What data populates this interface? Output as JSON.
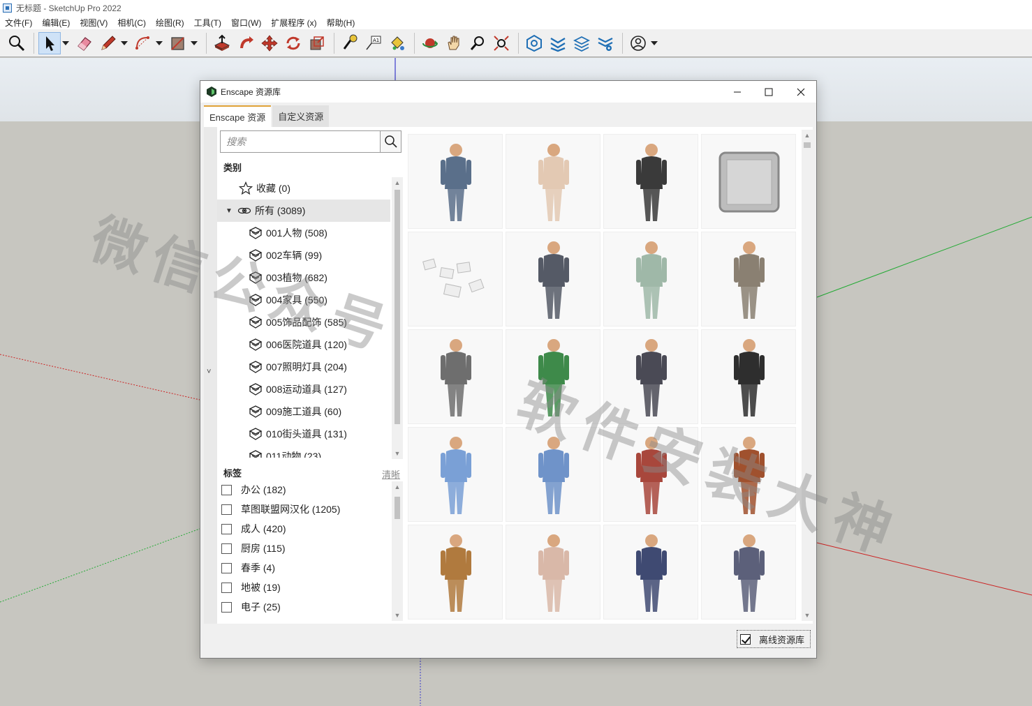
{
  "app": {
    "title": "无标题 - SketchUp Pro 2022",
    "menus": [
      "文件(F)",
      "编辑(E)",
      "视图(V)",
      "相机(C)",
      "绘图(R)",
      "工具(T)",
      "窗口(W)",
      "扩展程序 (x)",
      "帮助(H)"
    ]
  },
  "toolbar": {
    "tools": [
      "zoom-icon",
      "select-icon",
      "eraser-icon",
      "pencil-icon",
      "arc-icon",
      "shape-icon",
      "push-pull-icon",
      "follow-me-icon",
      "move-icon",
      "rotate-icon",
      "scale-icon",
      "tape-measure-icon",
      "text-icon",
      "paint-bucket-icon",
      "orbit-icon",
      "pan-icon",
      "zoom-window-icon",
      "zoom-extents-icon",
      "warehouse-icon",
      "components-icon",
      "extension-warehouse-icon",
      "settings-icon",
      "account-icon"
    ]
  },
  "dialog": {
    "title": "Enscape 资源库",
    "tabs": {
      "builtin": "Enscape 资源",
      "custom": "自定义资源"
    },
    "search": {
      "placeholder": "搜索",
      "value": ""
    },
    "category_title": "类别",
    "categories": [
      {
        "label": "收藏 (0)",
        "icon": "star-icon"
      },
      {
        "label": "所有 (3089)",
        "icon": "all-icon"
      },
      {
        "label": "001人物 (508)",
        "icon": "category-icon"
      },
      {
        "label": "002车辆 (99)",
        "icon": "category-icon"
      },
      {
        "label": "003植物 (682)",
        "icon": "category-icon"
      },
      {
        "label": "004家具 (550)",
        "icon": "category-icon"
      },
      {
        "label": "005饰品配饰 (585)",
        "icon": "category-icon"
      },
      {
        "label": "006医院道具 (120)",
        "icon": "category-icon"
      },
      {
        "label": "007照明灯具 (204)",
        "icon": "category-icon"
      },
      {
        "label": "008运动道具 (127)",
        "icon": "category-icon"
      },
      {
        "label": "009施工道具 (60)",
        "icon": "category-icon"
      },
      {
        "label": "010街头道具 (131)",
        "icon": "category-icon"
      },
      {
        "label": "011动物 (23)",
        "icon": "category-icon"
      }
    ],
    "tags_title": "标签",
    "clear_label": "清晰",
    "tags": [
      "办公 (182)",
      "草图联盟网汉化 (1205)",
      "成人 (420)",
      "厨房 (115)",
      "春季 (4)",
      "地被 (19)",
      "电子 (25)"
    ],
    "offline_label": "离线资源库",
    "offline_checked": true,
    "assets": [
      {
        "name": "man-on-phone",
        "color": "#5a6f8a"
      },
      {
        "name": "woman-in-suit",
        "color": "#e3c9b3"
      },
      {
        "name": "waiter-with-tray",
        "color": "#3a3a3a"
      },
      {
        "name": "ceiling-panel",
        "color": "#9a9a9a"
      },
      {
        "name": "papers",
        "color": "#dddddd"
      },
      {
        "name": "man-sitting-suit",
        "color": "#555a66"
      },
      {
        "name": "man-sitting-casual",
        "color": "#9fb8a8"
      },
      {
        "name": "man-on-bicycle",
        "color": "#8a8072"
      },
      {
        "name": "man-gray-suit",
        "color": "#6e6e6e"
      },
      {
        "name": "woman-green-dress",
        "color": "#3e8a4a"
      },
      {
        "name": "woman-with-jacket",
        "color": "#4a4a55"
      },
      {
        "name": "man-black-outfit",
        "color": "#2e2e2e"
      },
      {
        "name": "doctor-blue",
        "color": "#7aa0d6"
      },
      {
        "name": "doctor-clipboard",
        "color": "#6f93c9"
      },
      {
        "name": "woman-red-jacket",
        "color": "#a8473c"
      },
      {
        "name": "woman-sitting-rust",
        "color": "#a0512e"
      },
      {
        "name": "woman-reading",
        "color": "#b07a3e"
      },
      {
        "name": "mother-and-child",
        "color": "#d9b8a8"
      },
      {
        "name": "man-navy-suit",
        "color": "#3f4a72"
      },
      {
        "name": "man-with-suitcase",
        "color": "#5c607a"
      }
    ]
  },
  "watermark": {
    "text": "微信公众号 软件安装大神",
    "line1": "微信公众号",
    "line2": "软件安装大神"
  }
}
